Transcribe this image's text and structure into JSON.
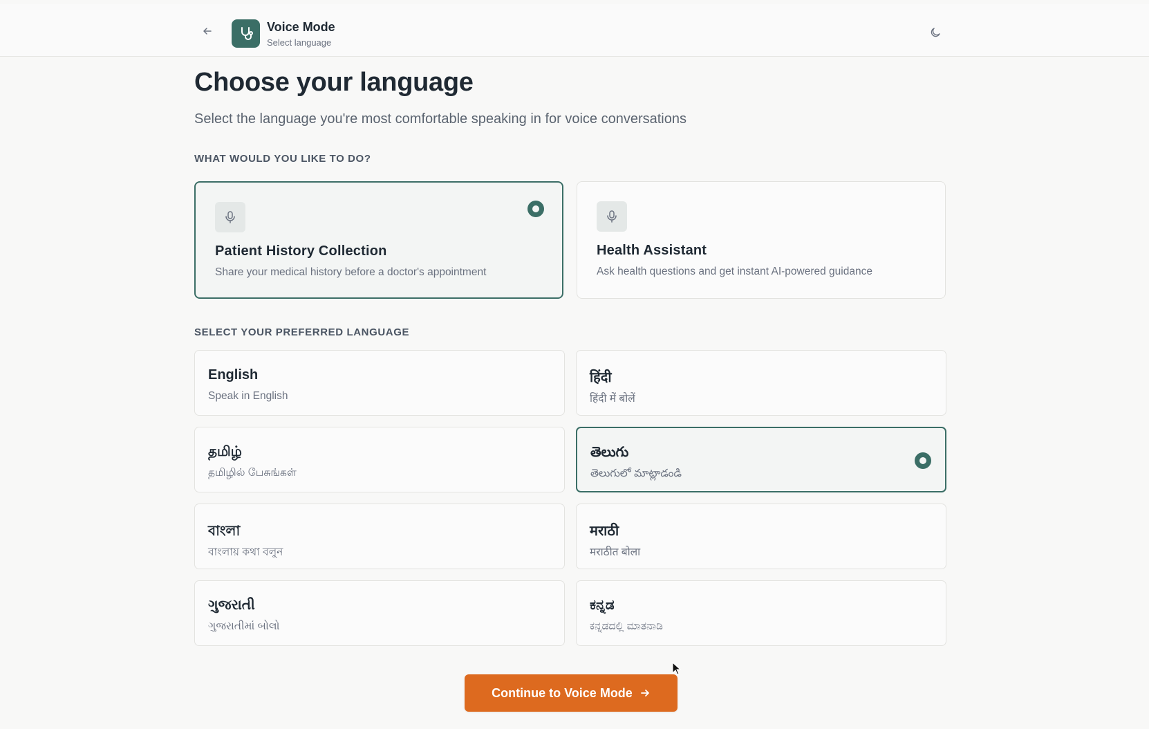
{
  "header": {
    "title": "Voice Mode",
    "subtitle": "Select language",
    "back_icon": "arrow-left-icon",
    "logo_icon": "stethoscope-icon",
    "theme_icon": "moon-icon"
  },
  "page": {
    "heading": "Choose your language",
    "subheading": "Select the language you're most comfortable speaking in for voice conversations"
  },
  "mode_section": {
    "label": "WHAT WOULD YOU LIKE TO DO?",
    "options": [
      {
        "title": "Patient History Collection",
        "description": "Share your medical history before a doctor's appointment",
        "icon": "microphone-icon",
        "selected": true
      },
      {
        "title": "Health Assistant",
        "description": "Ask health questions and get instant AI-powered guidance",
        "icon": "microphone-icon",
        "selected": false
      }
    ]
  },
  "language_section": {
    "label": "SELECT YOUR PREFERRED LANGUAGE",
    "languages": [
      {
        "name": "English",
        "subtitle": "Speak in English",
        "selected": false
      },
      {
        "name": "हिंदी",
        "subtitle": "हिंदी में बोलें",
        "selected": false
      },
      {
        "name": "தமிழ்",
        "subtitle": "தமிழில் பேசுங்கள்",
        "selected": false
      },
      {
        "name": "తెలుగు",
        "subtitle": "తెలుగులో మాట్లాడండి",
        "selected": true
      },
      {
        "name": "বাংলা",
        "subtitle": "বাংলায় কথা বলুন",
        "selected": false
      },
      {
        "name": "मराठी",
        "subtitle": "मराठीत बोला",
        "selected": false
      },
      {
        "name": "ગુજરાતી",
        "subtitle": "ગુજરાતીમાં બોલો",
        "selected": false
      },
      {
        "name": "ಕನ್ನಡ",
        "subtitle": "ಕನ್ನಡದಲ್ಲಿ ಮಾತನಾಡಿ",
        "selected": false
      }
    ]
  },
  "actions": {
    "continue_label": "Continue to Voice Mode",
    "continue_icon": "arrow-right-icon"
  },
  "colors": {
    "accent": "#3b6e66",
    "button": "#dd6a1f",
    "background": "#f8f8f7"
  }
}
